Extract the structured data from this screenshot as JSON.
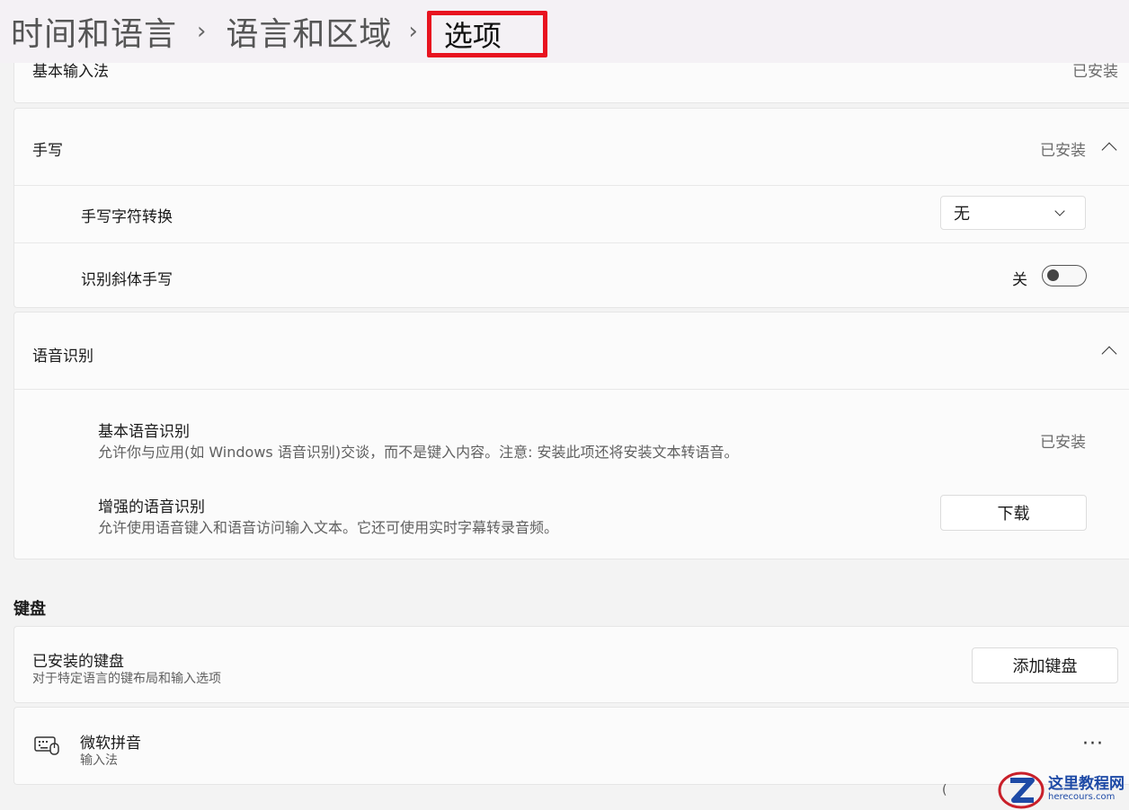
{
  "breadcrumb": {
    "items": [
      "时间和语言",
      "语言和区域"
    ],
    "current": "选项",
    "separator": "›"
  },
  "basic_input": {
    "label": "基本输入法",
    "status": "已安装"
  },
  "handwriting": {
    "title": "手写",
    "status": "已安装",
    "conversion": {
      "label": "手写字符转换",
      "value": "无"
    },
    "italic": {
      "label": "识别斜体手写",
      "state": "关",
      "enabled": false
    }
  },
  "speech": {
    "title": "语音识别",
    "basic": {
      "label": "基本语音识别",
      "desc": "允许你与应用(如 Windows 语音识别)交谈，而不是键入内容。注意: 安装此项还将安装文本转语音。",
      "status": "已安装"
    },
    "enhanced": {
      "label": "增强的语音识别",
      "desc": "允许使用语音键入和语音访问输入文本。它还可使用实时字幕转录音频。",
      "button": "下载"
    }
  },
  "keyboard": {
    "section": "键盘",
    "installed": {
      "label": "已安装的键盘",
      "desc": "对于特定语言的键布局和输入选项",
      "button": "添加键盘"
    },
    "item": {
      "name": "微软拼音",
      "type": "输入法",
      "more": "···"
    }
  },
  "watermark": {
    "text": "这里教程网",
    "url": "herecours.com"
  },
  "misc": {
    "paren": "("
  },
  "colors": {
    "highlight_border": "#e8131f",
    "watermark_blue": "#1e4aa6"
  }
}
